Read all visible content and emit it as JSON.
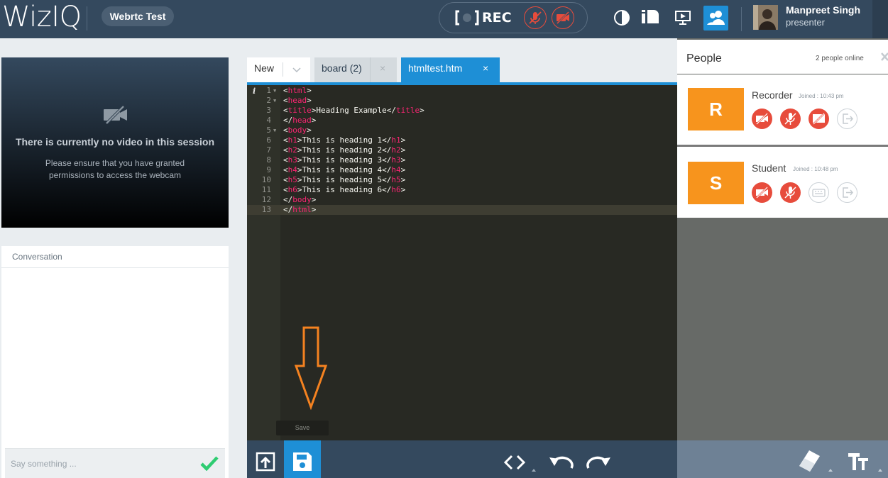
{
  "header": {
    "logo": "WizIQ",
    "session_name": "Webrtc Test",
    "rec_label": "REC",
    "user": {
      "name": "Manpreet Singh",
      "role": "presenter"
    }
  },
  "video": {
    "message": "There is currently no video in this session",
    "sub_message": "Please ensure that you have granted permissions to access the webcam"
  },
  "conversation": {
    "title": "Conversation",
    "input_placeholder": "Say something ..."
  },
  "editor": {
    "tabs": [
      {
        "label": "New"
      },
      {
        "label": "board (2)",
        "close": "×"
      },
      {
        "label": "htmltest.htm",
        "close": "×"
      }
    ],
    "lines": [
      {
        "n": "1",
        "text": "<html>"
      },
      {
        "n": "2",
        "text": "<head>"
      },
      {
        "n": "3",
        "text": "<title>Heading Example</title>"
      },
      {
        "n": "4",
        "text": "</head>"
      },
      {
        "n": "5",
        "text": "<body>"
      },
      {
        "n": "6",
        "text": "<h1>This is heading 1</h1>"
      },
      {
        "n": "7",
        "text": "<h2>This is heading 2</h2>"
      },
      {
        "n": "8",
        "text": "<h3>This is heading 3</h3>"
      },
      {
        "n": "9",
        "text": "<h4>This is heading 4</h4>"
      },
      {
        "n": "10",
        "text": "<h5>This is heading 5</h5>"
      },
      {
        "n": "11",
        "text": "<h6>This is heading 6</h6>"
      },
      {
        "n": "12",
        "text": "</body>"
      },
      {
        "n": "13",
        "text": "</html>"
      }
    ],
    "save_tooltip": "Save"
  },
  "people": {
    "title": "People",
    "count": "2 people online",
    "list": [
      {
        "initial": "R",
        "name": "Recorder",
        "joined": "Joined : 10:43 pm"
      },
      {
        "initial": "S",
        "name": "Student",
        "joined": "Joined : 10:48 pm"
      }
    ]
  },
  "colors": {
    "topbar": "#34495e",
    "accent_blue": "#1e8fd6",
    "avatar_orange": "#f7941d",
    "danger_red": "#e74c3c",
    "annotation_arrow": "#f58220"
  },
  "icons": {
    "topbar": [
      "record-icon",
      "mic-off-icon",
      "camera-off-icon",
      "contrast-icon",
      "layout-icon",
      "screen-share-icon",
      "people-icon"
    ],
    "bottom_toolbar": [
      "upload-icon",
      "save-icon",
      "code-icon",
      "undo-icon",
      "redo-icon",
      "eraser-icon",
      "text-size-icon"
    ]
  }
}
